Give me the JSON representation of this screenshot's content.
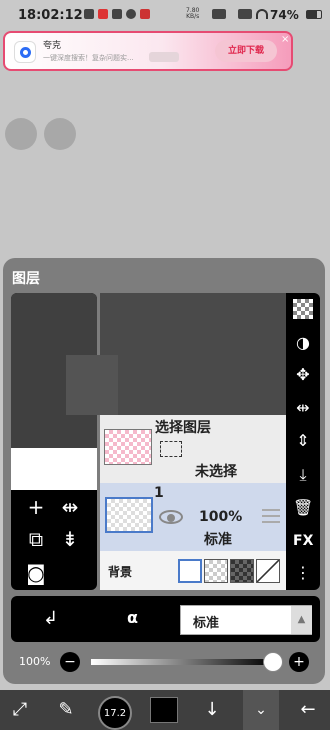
{
  "status_bar": {
    "time": "18:02:12",
    "net_speed_value": "7.80",
    "net_speed_unit": "KB/s",
    "battery": "74%"
  },
  "ad": {
    "title": "夸克",
    "subtitle": "一键深度搜索！复杂问题实...",
    "button": "立即下载",
    "close": "×"
  },
  "layers_panel": {
    "title": "图层",
    "selection_layer": {
      "title": "选择图层",
      "status": "未选择"
    },
    "layer": {
      "number": "1",
      "opacity": "100%",
      "blend": "标准"
    },
    "background": {
      "label": "背景"
    },
    "blend_mode": {
      "value": "标准"
    },
    "opacity": {
      "label": "100%",
      "value": 1.0
    },
    "fx_label": "FX"
  },
  "toolbar": {
    "brush_size": "17.2"
  },
  "colors": {
    "accent": "#e64b72",
    "selected_layer": "#cfd9ec",
    "selected_border": "#4a7ac9"
  }
}
